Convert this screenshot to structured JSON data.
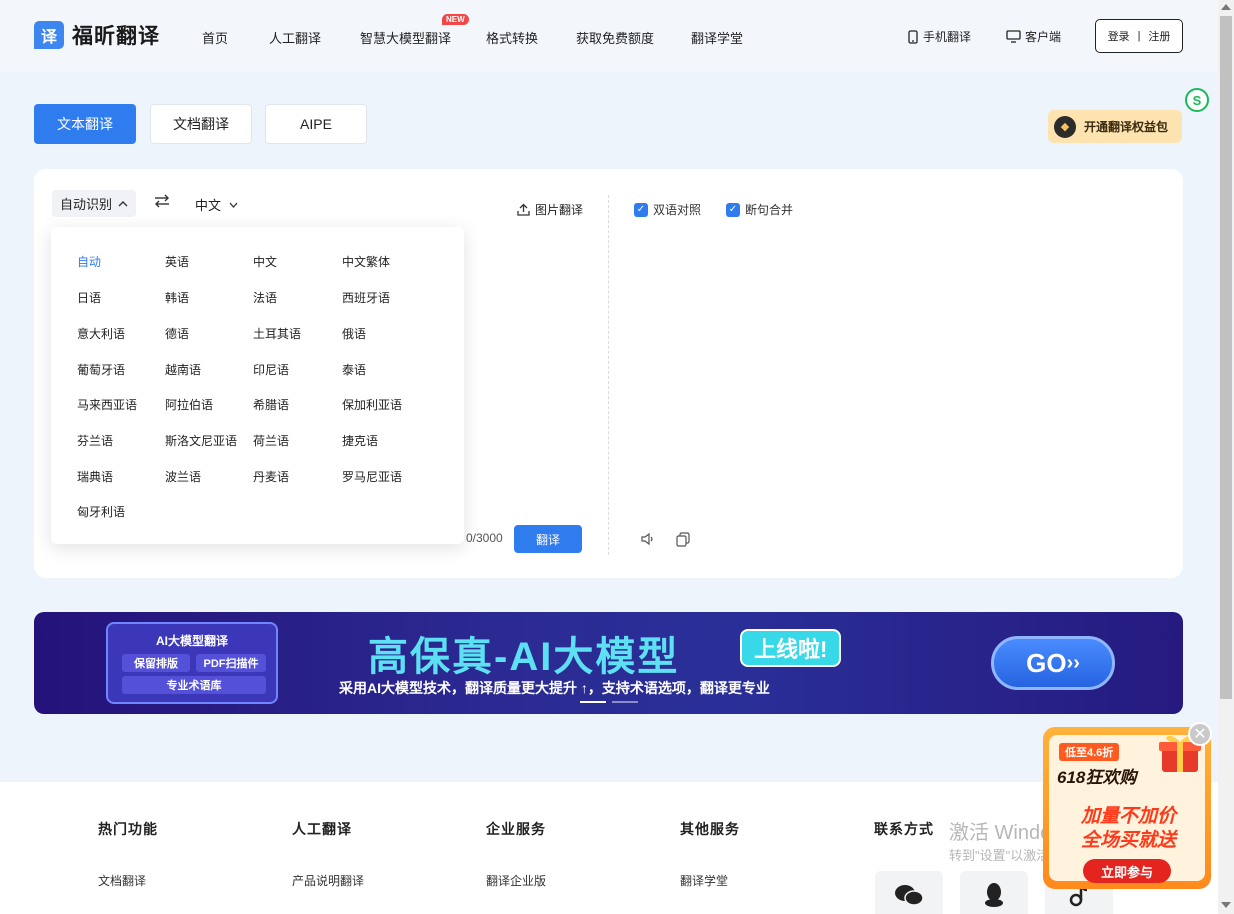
{
  "brand": {
    "logo_glyph": "译",
    "name": "福昕翻译"
  },
  "nav": {
    "items": [
      "首页",
      "人工翻译",
      "智慧大模型翻译",
      "格式转换",
      "获取免费额度",
      "翻译学堂"
    ],
    "new_badge": "NEW",
    "mobile": "手机翻译",
    "client": "客户端",
    "login": "登录",
    "sep": "|",
    "register": "注册"
  },
  "modes": {
    "text": "文本翻译",
    "doc": "文档翻译",
    "aipe": "AIPE"
  },
  "benefit": {
    "label": "开通翻译权益包"
  },
  "translator": {
    "source_lang": "自动识别",
    "target_lang": "中文",
    "image_translate": "图片翻译",
    "bilingual": "双语对照",
    "merge": "断句合并",
    "char_count": "0/3000",
    "translate_btn": "翻译"
  },
  "dropdown": {
    "languages": [
      "自动",
      "英语",
      "中文",
      "中文繁体",
      "日语",
      "韩语",
      "法语",
      "西班牙语",
      "意大利语",
      "德语",
      "土耳其语",
      "俄语",
      "葡萄牙语",
      "越南语",
      "印尼语",
      "泰语",
      "马来西亚语",
      "阿拉伯语",
      "希腊语",
      "保加利亚语",
      "芬兰语",
      "斯洛文尼亚语",
      "荷兰语",
      "捷克语",
      "瑞典语",
      "波兰语",
      "丹麦语",
      "罗马尼亚语",
      "匈牙利语"
    ],
    "selected": "自动"
  },
  "banner": {
    "tag_title": "AI大模型翻译",
    "chip1": "保留排版",
    "chip2": "PDF扫描件",
    "chip3": "专业术语库",
    "headline": "高保真-AI大模型",
    "online": "上线啦!",
    "sub": "采用AI大模型技术，翻译质量更大提升 ↑，支持术语选项，翻译更专业",
    "go": "GO"
  },
  "footer": {
    "headings": [
      "热门功能",
      "人工翻译",
      "企业服务",
      "其他服务",
      "联系方式"
    ],
    "links": [
      "文档翻译",
      "产品说明翻译",
      "翻译企业版",
      "翻译学堂"
    ]
  },
  "watermark": {
    "line1": "激活 Windows",
    "line2": "转到\"设置\"以激活 Windows。"
  },
  "promo": {
    "badge": "低至4.6折",
    "title": "618狂欢购",
    "line1": "加量不加价",
    "line2": "全场买就送",
    "btn": "立即参与"
  },
  "colors": {
    "accent": "#2f7cef",
    "banner": "#24127a",
    "promo": "#ff8a1c"
  }
}
